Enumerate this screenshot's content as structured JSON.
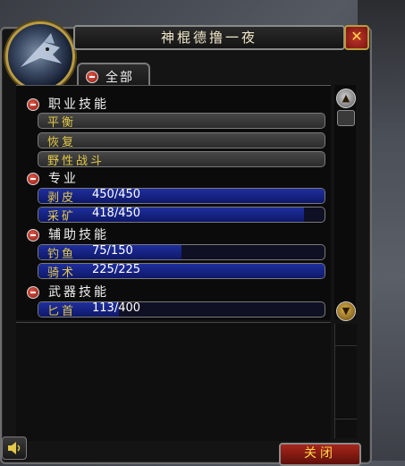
{
  "window": {
    "title": "神棍德撸一夜",
    "close_x": "✕",
    "tab_label": "全部",
    "close_button": "关闭"
  },
  "colors": {
    "skill_name": "#e2c84a",
    "skill_value": "#ffffff",
    "bar_fill": "#1f2f9e",
    "category_text": "#f2f2f2"
  },
  "categories": [
    {
      "label": "职业技能",
      "skills": [
        {
          "name": "平衡",
          "value": "",
          "fill": 0
        },
        {
          "name": "恢复",
          "value": "",
          "fill": 0
        },
        {
          "name": "野性战斗",
          "value": "",
          "fill": 0
        }
      ]
    },
    {
      "label": "专业",
      "skills": [
        {
          "name": "剥皮",
          "value": "450/450",
          "fill": 1.0
        },
        {
          "name": "采矿",
          "value": "418/450",
          "fill": 0.929
        }
      ]
    },
    {
      "label": "辅助技能",
      "skills": [
        {
          "name": "钓鱼",
          "value": "75/150",
          "fill": 0.5
        },
        {
          "name": "骑术",
          "value": "225/225",
          "fill": 1.0
        }
      ]
    },
    {
      "label": "武器技能",
      "skills": [
        {
          "name": "匕首",
          "value": "113/400",
          "fill": 0.2825
        }
      ]
    }
  ]
}
